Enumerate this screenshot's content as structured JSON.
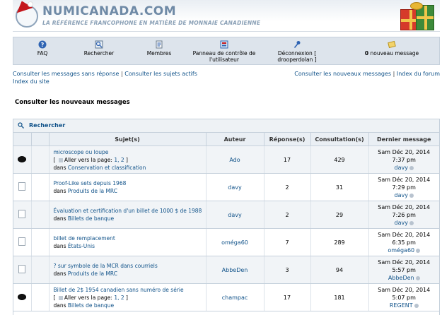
{
  "header": {
    "site_title": "NUMICANADA.COM",
    "tagline": "LA RÉFÉRENCE FRANCOPHONE EN MATIÈRE DE MONNAIE CANADIENNE"
  },
  "nav": {
    "faq": "FAQ",
    "search": "Rechercher",
    "members": "Membres",
    "ucp_line1": "Panneau de contrôle de",
    "ucp_line2": "l'utilisateur",
    "logout": "Déconnexion [ drooperdolan ]",
    "new_msg_count": "0",
    "new_msg_label": " nouveau message"
  },
  "links": {
    "unanswered": "Consulter les messages sans réponse",
    "active": "Consulter les sujets actifs",
    "new_posts": "Consulter les nouveaux messages",
    "forum_index": "Index du forum",
    "site_index": "Index du site",
    "sep": "|"
  },
  "page_title": "Consulter les nouveaux messages",
  "search_label": "Rechercher",
  "columns": {
    "subject": "Sujet(s)",
    "author": "Auteur",
    "replies": "Réponse(s)",
    "views": "Consultation(s)",
    "last": "Dernier message"
  },
  "topics": [
    {
      "title": "microscope ou loupe",
      "goto": "[ ",
      "goto_label": "Aller vers la page: ",
      "pages": "1, 2",
      "goto_end": " ]",
      "in_word": "dans ",
      "forum": "Conservation et classification",
      "author": "Ado",
      "replies": "17",
      "views": "429",
      "date": "Sam Déc 20, 2014",
      "time": "7:37 pm",
      "by": "davy",
      "hot": true
    },
    {
      "title": "Proof-Like sets depuis 1968",
      "in_word": "dans ",
      "forum": "Produits de la MRC",
      "author": "davy",
      "replies": "2",
      "views": "31",
      "date": "Sam Déc 20, 2014",
      "time": "7:29 pm",
      "by": "davy",
      "hot": false
    },
    {
      "title": "Évaluation et certification d'un billet de 1000 $ de 1988",
      "in_word": "dans ",
      "forum": "Billets de banque",
      "author": "davy",
      "replies": "2",
      "views": "29",
      "date": "Sam Déc 20, 2014",
      "time": "7:26 pm",
      "by": "davy",
      "hot": false
    },
    {
      "title": "billet de remplacement",
      "in_word": "dans ",
      "forum": "États-Unis",
      "author": "oméga60",
      "replies": "7",
      "views": "289",
      "date": "Sam Déc 20, 2014",
      "time": "6:35 pm",
      "by": "oméga60",
      "hot": false
    },
    {
      "title": "? sur symbole de la MCR dans courriels",
      "in_word": "dans ",
      "forum": "Produits de la MRC",
      "author": "AbbeDen",
      "replies": "3",
      "views": "94",
      "date": "Sam Déc 20, 2014",
      "time": "5:57 pm",
      "by": "AbbeDen",
      "hot": false
    },
    {
      "title": "Billet de 2$ 1954 canadien sans numéro de série",
      "goto": "[ ",
      "goto_label": "Aller vers la page: ",
      "pages": "1, 2",
      "goto_end": " ]",
      "in_word": "dans ",
      "forum": "Billets de banque",
      "author": "champac",
      "replies": "17",
      "views": "181",
      "date": "Sam Déc 20, 2014",
      "time": "5:07 pm",
      "by": "REGENT",
      "hot": true
    }
  ]
}
